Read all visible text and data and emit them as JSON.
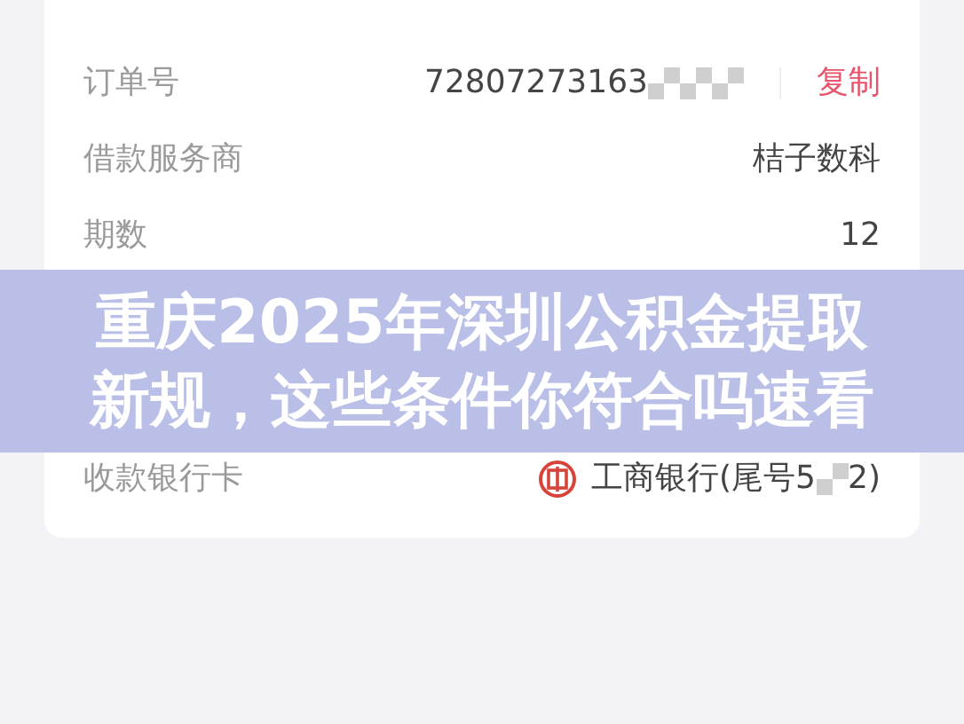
{
  "order_details": {
    "rows": [
      {
        "kind": "copy",
        "label": "订单号",
        "value": "72807273163",
        "action": "复制"
      },
      {
        "kind": "plain",
        "label": "借款服务商",
        "value": "桔子数科"
      },
      {
        "kind": "plain",
        "label": "期数",
        "value": "12"
      },
      {
        "kind": "bank",
        "label": "收款银行卡",
        "value": "工商银行(尾号5",
        "value_end": "2)"
      }
    ]
  },
  "banner": {
    "lines": [
      "重庆2025年深圳公积金提取",
      "新规，这些条件你符合吗速看"
    ]
  }
}
